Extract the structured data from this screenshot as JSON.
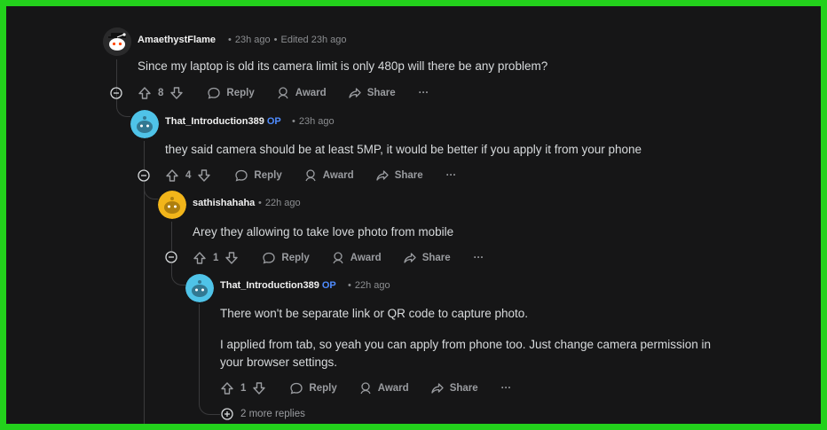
{
  "comments": [
    {
      "author": "AmaethystFlame",
      "op_tag": "",
      "time": "23h ago",
      "edited": "Edited 23h ago",
      "body": [
        "Since my laptop is old its camera limit is only 480p will there be any problem?"
      ],
      "votes": "8",
      "avatar_color": "#2a2a2b"
    },
    {
      "author": "That_Introduction389",
      "op_tag": "OP",
      "time": "23h ago",
      "body": [
        "they said camera should be at least 5MP, it would be better if you apply it from your phone"
      ],
      "votes": "4",
      "avatar_color": "#4fc3e8"
    },
    {
      "author": "sathishahaha",
      "op_tag": "",
      "time": "22h ago",
      "body": [
        "Arey they allowing to take love photo from mobile"
      ],
      "votes": "1",
      "avatar_color": "#f2b51a"
    },
    {
      "author": "That_Introduction389",
      "op_tag": "OP",
      "time": "22h ago",
      "body": [
        "There won't be separate link or QR code to capture photo.",
        "I applied from tab, so yeah you can apply from phone too. Just change camera permission in your browser settings."
      ],
      "votes": "1",
      "avatar_color": "#4fc3e8"
    }
  ],
  "actions": {
    "reply": "Reply",
    "award": "Award",
    "share": "Share",
    "more": "···"
  },
  "more_replies": "2 more replies",
  "colors": {
    "frame": "#23d11c",
    "background": "#161617",
    "op": "#4f8cff"
  },
  "icons": [
    "upvote-icon",
    "downvote-icon",
    "reply-icon",
    "award-icon",
    "share-icon",
    "collapse-icon",
    "expand-icon"
  ]
}
